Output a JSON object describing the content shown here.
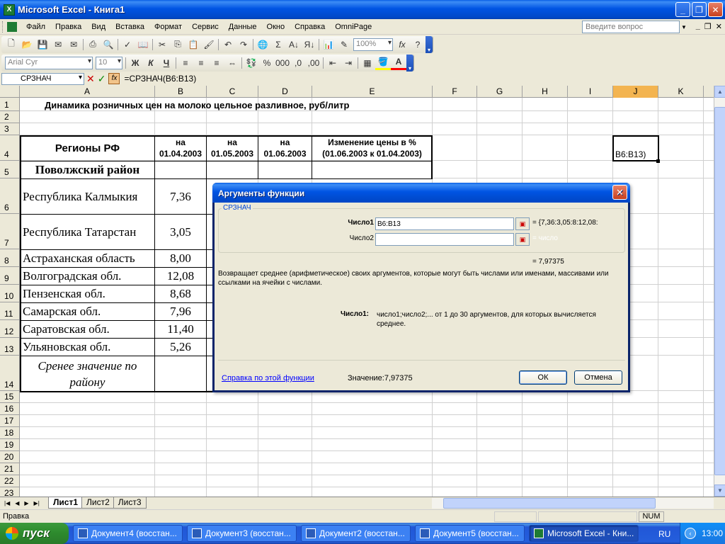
{
  "window": {
    "title": "Microsoft Excel - Книга1",
    "app_icon": "X"
  },
  "menu": {
    "items": [
      "Файл",
      "Правка",
      "Вид",
      "Вставка",
      "Формат",
      "Сервис",
      "Данные",
      "Окно",
      "Справка",
      "OmniPage"
    ],
    "help_placeholder": "Введите вопрос"
  },
  "toolbar": {
    "zoom": "100%",
    "font_name": "Arial Cyr",
    "font_size": "10",
    "bold": "Ж",
    "italic": "К",
    "underline": "Ч"
  },
  "formula_bar": {
    "name_box": "СРЗНАЧ",
    "formula": "=СРЗНАЧ(B6:B13)"
  },
  "grid": {
    "columns": [
      "A",
      "B",
      "C",
      "D",
      "E",
      "F",
      "G",
      "H",
      "I",
      "J",
      "K"
    ],
    "selected_column": "J",
    "rows": [
      "1",
      "2",
      "3",
      "4",
      "5",
      "6",
      "7",
      "8",
      "9",
      "10",
      "11",
      "12",
      "13",
      "14",
      "15",
      "16",
      "17",
      "18",
      "19",
      "20",
      "21",
      "22",
      "23"
    ],
    "title": "Динамика розничных цен на молоко цельное разливное, руб/литр",
    "header": {
      "region": "Регионы РФ",
      "b": [
        "на",
        "01.04.2003"
      ],
      "c": [
        "на",
        "01.05.2003"
      ],
      "d": [
        "на",
        "01.06.2003"
      ],
      "e": [
        "Изменение цены в %",
        "(01.06.2003 к 01.04.2003)"
      ]
    },
    "district": "Поволжский район",
    "data_rows": [
      {
        "name": "Республика Калмыкия",
        "value": "7,36"
      },
      {
        "name": "Республика Татарстан",
        "value": "3,05"
      },
      {
        "name": "Астраханская область",
        "value": "8,00"
      },
      {
        "name": "Волгоградская обл.",
        "value": "12,08"
      },
      {
        "name": "Пензенская обл.",
        "value": "8,68"
      },
      {
        "name": "Самарская обл.",
        "value": "7,96"
      },
      {
        "name": "Саратовская обл.",
        "value": "11,40"
      },
      {
        "name": "Ульяновская обл.",
        "value": "5,26"
      }
    ],
    "average_label_1": "Сренее значение по",
    "average_label_2": "району",
    "active_cell_text": "В6:В13)"
  },
  "dialog": {
    "title": "Аргументы функции",
    "function_name": "СРЗНАЧ",
    "arg1_label": "Число1",
    "arg1_value": "B6:B13",
    "arg1_result": "= {7,36:3,05:8:12,08:",
    "arg2_label": "Число2",
    "arg2_value": "",
    "arg2_result": "= число",
    "result_eq": "= 7,97375",
    "description": "Возвращает среднее (арифметическое) своих аргументов, которые могут быть числами или именами, массивами или ссылками на ячейки с числами.",
    "arg_help_label": "Число1:",
    "arg_help": "число1;число2;... от 1 до 30 аргументов, для которых вычисляется среднее.",
    "help_link": "Справка по этой функции",
    "value_text": "Значение:7,97375",
    "ok_label": "ОК",
    "cancel_label": "Отмена"
  },
  "sheets": {
    "tabs": [
      "Лист1",
      "Лист2",
      "Лист3"
    ],
    "active": 0
  },
  "status": {
    "mode": "Правка",
    "num": "NUM"
  },
  "taskbar": {
    "start_label": "пуск",
    "tasks": [
      {
        "label": "Документ4 (восстан...",
        "app": "word",
        "active": false
      },
      {
        "label": "Документ3 (восстан...",
        "app": "word",
        "active": false
      },
      {
        "label": "Документ2 (восстан...",
        "app": "word",
        "active": false
      },
      {
        "label": "Документ5 (восстан...",
        "app": "word",
        "active": false
      },
      {
        "label": "Microsoft Excel - Кни...",
        "app": "excel",
        "active": true
      }
    ],
    "language": "RU",
    "clock": "13:00"
  },
  "colors": {
    "accent": "#0054e3",
    "selected_header": "#f3b450",
    "link": "#0000ff"
  }
}
